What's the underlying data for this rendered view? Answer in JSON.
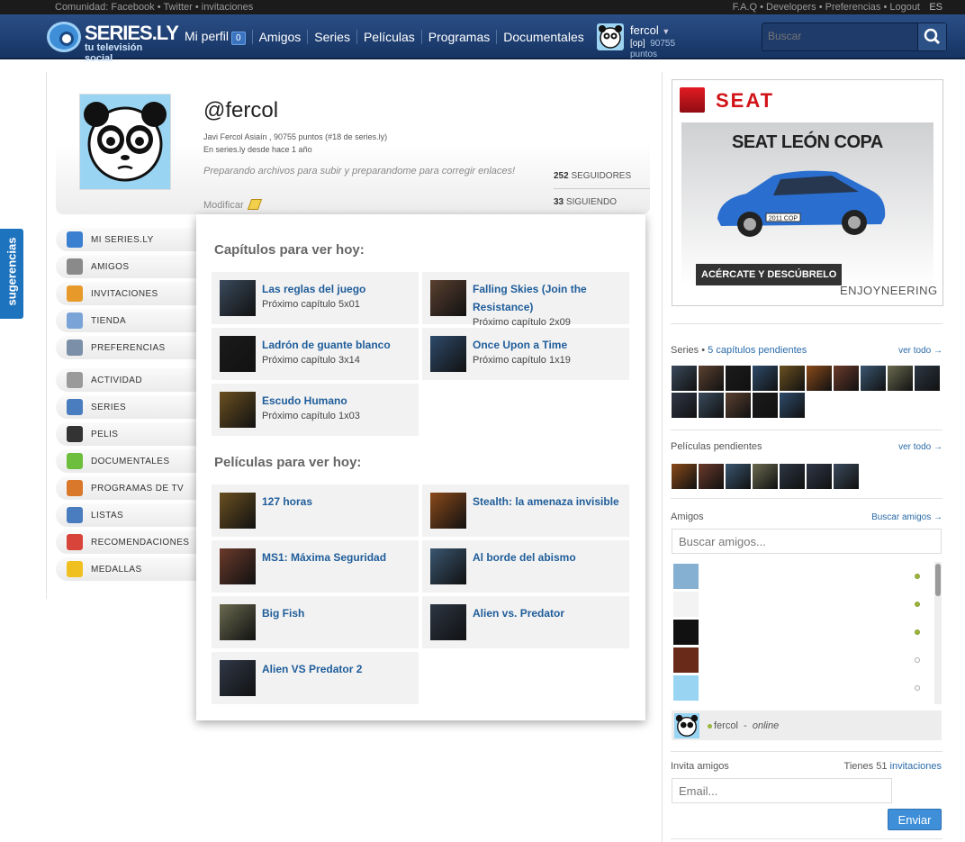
{
  "topbar": {
    "left": "Comunidad: Facebook • Twitter • invitaciones",
    "right": "F.A.Q • Developers • Preferencias • Logout",
    "lang": "ES"
  },
  "brand": {
    "name": "SERIES.LY",
    "tagline": "tu televisión social"
  },
  "nav": {
    "mi_perfil": "Mi perfil",
    "mi_perfil_badge": "0",
    "links": [
      "Amigos",
      "Series",
      "Películas",
      "Programas",
      "Documentales"
    ]
  },
  "user": {
    "name": "fercol",
    "tag": "[op]",
    "points": "90755",
    "points_label": "puntos"
  },
  "search": {
    "placeholder": "Buscar"
  },
  "sidebar_tab": "sugerencias",
  "profile": {
    "handle": "@fercol",
    "info_line1": "Javi Fercol Asiaín , 90755 puntos (#18 de series.ly)",
    "info_line2": "En series.ly desde hace 1 año",
    "quote": "Preparando archivos para subir y preparandome para corregir enlaces!",
    "modify": "Modificar",
    "followers_count": "252",
    "followers_label": "SEGUIDORES",
    "following_count": "33",
    "following_label": "SIGUIENDO"
  },
  "menu": {
    "items": [
      {
        "label": "MI SERIES.LY",
        "icon": "eye-icon",
        "color": "#3b7fd0"
      },
      {
        "label": "AMIGOS",
        "icon": "contacts-icon",
        "color": "#8a8a8a"
      },
      {
        "label": "INVITACIONES",
        "icon": "mail-icon",
        "color": "#e79a2a"
      },
      {
        "label": "TIENDA",
        "icon": "basket-icon",
        "color": "#7aa3d8"
      },
      {
        "label": "PREFERENCIAS",
        "icon": "gear-icon",
        "color": "#7c8fa8"
      },
      {
        "label": "ACTIVIDAD",
        "icon": "newspaper-icon",
        "color": "#9a9a9a"
      },
      {
        "label": "SERIES",
        "icon": "film-icon",
        "color": "#4a7cc0"
      },
      {
        "label": "PELIS",
        "icon": "clapper-icon",
        "color": "#333333"
      },
      {
        "label": "DOCUMENTALES",
        "icon": "camera-icon",
        "color": "#6cbe3c"
      },
      {
        "label": "PROGRAMAS DE TV",
        "icon": "tv-icon",
        "color": "#d9772a"
      },
      {
        "label": "LISTAS",
        "icon": "list-icon",
        "color": "#4a7cc0"
      },
      {
        "label": "RECOMENDACIONES",
        "icon": "heart-icon",
        "color": "#d8433a"
      },
      {
        "label": "MEDALLAS",
        "icon": "medal-icon",
        "color": "#f0c020"
      }
    ]
  },
  "popup": {
    "chapters_heading": "Capítulos para ver hoy:",
    "chapters": [
      {
        "title": "Las reglas del juego",
        "sub": "Próximo capítulo 5x01"
      },
      {
        "title": "Falling Skies (Join the Resistance)",
        "sub": "Próximo capítulo 2x09"
      },
      {
        "title": "Ladrón de guante blanco",
        "sub": "Próximo capítulo 3x14"
      },
      {
        "title": "Once Upon a Time",
        "sub": "Próximo capítulo 1x19"
      },
      {
        "title": "Escudo Humano",
        "sub": "Próximo capítulo 1x03"
      }
    ],
    "movies_heading": "Películas para ver hoy:",
    "movies": [
      {
        "title": "127 horas"
      },
      {
        "title": "Stealth: la amenaza invisible"
      },
      {
        "title": "MS1: Máxima Seguridad"
      },
      {
        "title": "Al borde del abismo"
      },
      {
        "title": "Big Fish"
      },
      {
        "title": "Alien vs. Predator"
      },
      {
        "title": "Alien VS Predator 2"
      }
    ]
  },
  "ad": {
    "brand": "SEAT",
    "headline": "SEAT LEÓN COPA",
    "plate": "2011 COP",
    "cta": "ACÉRCATE Y DESCÚBRELO",
    "slogan": "ENJOYNEERING"
  },
  "right": {
    "series_label": "Series",
    "series_pending": "5 capítulos pendientes",
    "series_see_all": "ver todo →",
    "movies_label": "Películas pendientes",
    "movies_see_all": "ver todo →",
    "friends_label": "Amigos",
    "friends_find": "Buscar amigos →",
    "friends_search_placeholder": "Buscar amigos...",
    "self_name": "fercol",
    "self_dash": "-",
    "self_status": "online",
    "invite_label": "Invita amigos",
    "invite_have": "Tienes 51",
    "invite_link": "invitaciones",
    "email_placeholder": "Email...",
    "send": "Enviar"
  }
}
